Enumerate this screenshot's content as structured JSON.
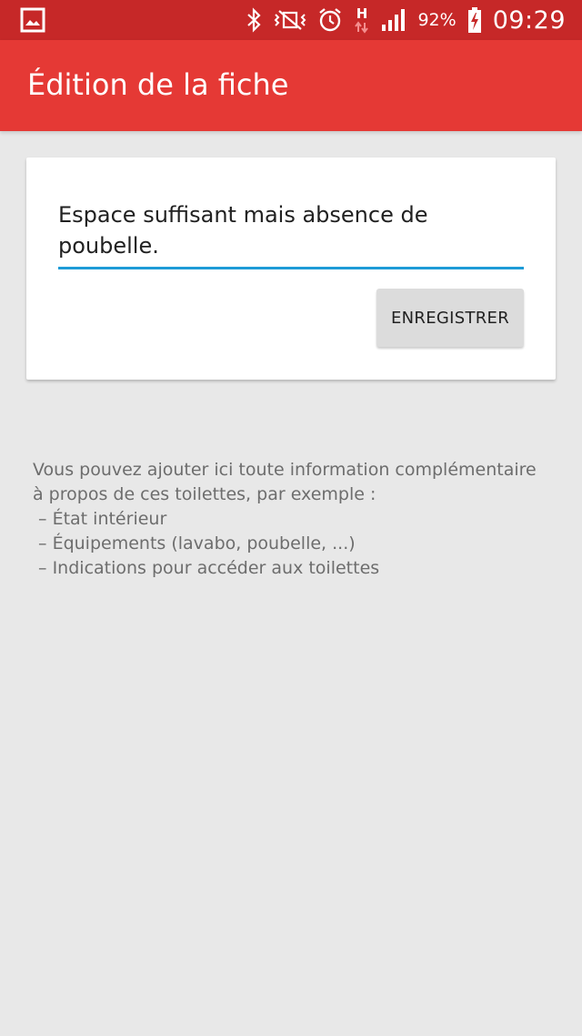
{
  "status_bar": {
    "left_icon": "gallery-icon",
    "icons": [
      "bluetooth-icon",
      "vibrate-icon",
      "alarm-icon",
      "h-network-icon",
      "signal-icon",
      "battery-charging-icon"
    ],
    "battery_percent": "92%",
    "time": "09:29",
    "network_type": "H"
  },
  "app_bar": {
    "title": "Édition de la fiche",
    "color": "#e53935"
  },
  "editor": {
    "value": "Espace suffisant mais absence de poubelle.",
    "accent_color": "#1e9bd7",
    "save_label": "ENREGISTRER"
  },
  "help": {
    "lines": [
      "Vous pouvez ajouter ici toute information complémentaire",
      "à propos de ces toilettes, par exemple :",
      " – État intérieur",
      " – Équipements (lavabo, poubelle, ...)",
      " – Indications pour accéder aux toilettes"
    ]
  }
}
